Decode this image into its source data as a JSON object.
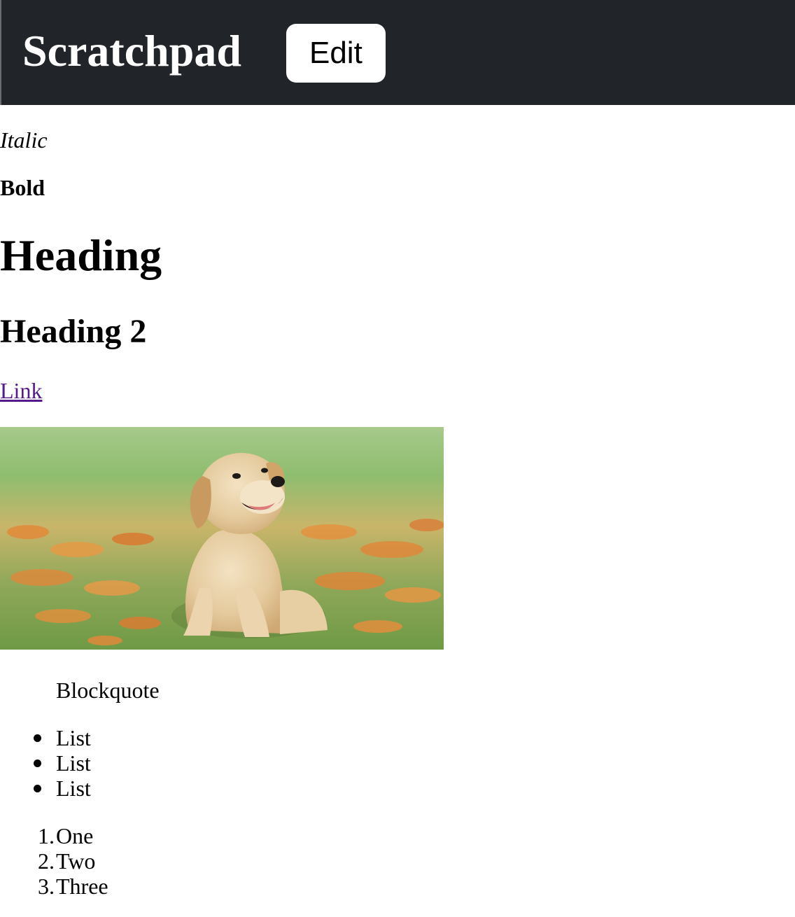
{
  "header": {
    "title": "Scratchpad",
    "edit_label": "Edit"
  },
  "content": {
    "italic": "Italic",
    "bold": "Bold",
    "heading1": "Heading",
    "heading2": "Heading 2",
    "link": "Link",
    "image_icon": "puppy-photo",
    "blockquote": "Blockquote",
    "bullet_list": [
      "List",
      "List",
      "List"
    ],
    "ordered_list": [
      {
        "marker": "1.",
        "text": "One"
      },
      {
        "marker": "2.",
        "text": "Two"
      },
      {
        "marker": "3.",
        "text": "Three"
      }
    ]
  },
  "colors": {
    "header_bg": "#212529",
    "link": "#551a8b",
    "button_bg": "#ffffff"
  }
}
